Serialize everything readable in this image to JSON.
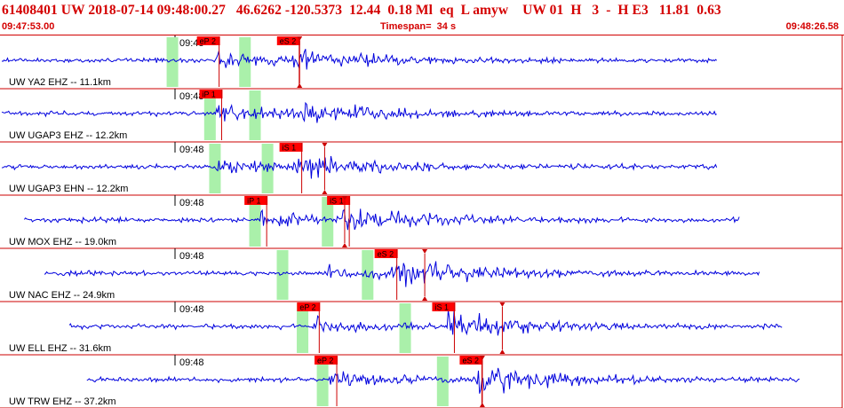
{
  "header": {
    "title": "61408401 UW 2018-07-14 09:48:00.27   46.6262 -120.5373  12.44  0.18 Ml  eq  L amyw    UW 01  H   3  -  H E3   11.81  0.63",
    "start_time": "09:47:53.00",
    "timespan": "Timespan=  34 s",
    "end_time": "09:48:26.58"
  },
  "colors": {
    "trace": "#0000dd",
    "pick": "#cc0000",
    "pick_label_bg": "#ff0000",
    "window": "#aaf0aa",
    "border": "#cc0000"
  },
  "panels": [
    {
      "label": "UW YA2 EHZ -- 11.1km",
      "time_label": "09:48",
      "picks": [
        {
          "label": "eP 2",
          "time": 8.4
        },
        {
          "label": "eS 2",
          "time": 11.6
        }
      ],
      "auto_marker_time": 11.9,
      "windows": [
        6.8,
        9.7
      ],
      "signal_start": 0.0,
      "signal_end": 28.6,
      "p_time": 8.4,
      "s_time": 11.6,
      "amp": 0.35
    },
    {
      "label": "UW UGAP3 EHZ -- 12.2km",
      "time_label": "09:48",
      "picks": [
        {
          "label": "iP 1",
          "time": 8.5
        }
      ],
      "auto_marker_time": null,
      "windows": [
        8.3,
        10.1
      ],
      "signal_start": 0.0,
      "signal_end": 28.6,
      "p_time": 8.5,
      "s_time": 12.0,
      "amp": 0.45
    },
    {
      "label": "UW UGAP3 EHN -- 12.2km",
      "time_label": "09:48",
      "picks": [
        {
          "label": "iS 1",
          "time": 11.7
        }
      ],
      "auto_marker_time": 12.9,
      "windows": [
        8.5,
        10.6
      ],
      "signal_start": 0.0,
      "signal_end": 28.6,
      "p_time": 8.5,
      "s_time": 11.7,
      "amp": 0.45
    },
    {
      "label": "UW MOX EHZ -- 19.0km",
      "time_label": "09:48",
      "picks": [
        {
          "label": "iP 1",
          "time": 10.3
        },
        {
          "label": "iS 1",
          "time": 13.6
        }
      ],
      "auto_marker_time": 13.7,
      "windows": [
        10.1,
        13.0
      ],
      "signal_start": 0.9,
      "signal_end": 29.5,
      "p_time": 10.3,
      "s_time": 13.6,
      "amp": 0.5
    },
    {
      "label": "UW NAC EHZ -- 24.9km",
      "time_label": "09:48",
      "picks": [
        {
          "label": "eS 2",
          "time": 15.5
        }
      ],
      "auto_marker_time": 16.9,
      "windows": [
        11.2,
        14.6
      ],
      "signal_start": 1.7,
      "signal_end": 30.3,
      "p_time": 13.0,
      "s_time": 15.5,
      "amp": 0.55
    },
    {
      "label": "UW ELL EHZ -- 31.6km",
      "time_label": "09:48",
      "picks": [
        {
          "label": "eP 2",
          "time": 12.4
        },
        {
          "label": "iS 1",
          "time": 17.8
        }
      ],
      "auto_marker_time": 20.0,
      "windows": [
        12.0,
        16.1
      ],
      "signal_start": 2.7,
      "signal_end": 31.2,
      "p_time": 12.4,
      "s_time": 17.8,
      "amp": 0.55
    },
    {
      "label": "UW TRW EHZ -- 37.2km",
      "time_label": "09:48",
      "picks": [
        {
          "label": "eP 2",
          "time": 13.1
        },
        {
          "label": "eS 2",
          "time": 18.9
        }
      ],
      "auto_marker_time": 19.2,
      "windows": [
        12.8,
        17.6
      ],
      "signal_start": 3.4,
      "signal_end": 31.9,
      "p_time": 13.1,
      "s_time": 18.9,
      "amp": 0.55
    }
  ]
}
